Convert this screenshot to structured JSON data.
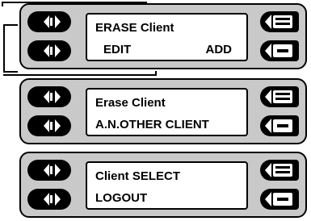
{
  "screens": [
    {
      "line1": "ERASE   Client",
      "left_softkey": "EDIT",
      "right_softkey": "ADD"
    },
    {
      "line1": "Erase Client",
      "line2": "A.N.OTHER CLIENT"
    },
    {
      "line1": "Client  SELECT",
      "line2": "LOGOUT"
    }
  ],
  "icons": {
    "nav": "up-down-arrow-icon",
    "top_side": "esc-del-icon",
    "bottom_side": "back-clear-icon"
  }
}
